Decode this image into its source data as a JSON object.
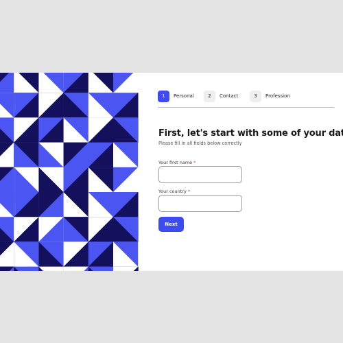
{
  "colors": {
    "accent": "#3d4bf0",
    "accent_dark": "#14105c",
    "accent_light": "#4a55f2",
    "required": "#e23b3b"
  },
  "steps": [
    {
      "number": "1",
      "label": "Personal",
      "active": true
    },
    {
      "number": "2",
      "label": "Contact",
      "active": false
    },
    {
      "number": "3",
      "label": "Profession",
      "active": false
    }
  ],
  "form": {
    "title": "First, let's start with some of your data",
    "subtitle": "Please fill in all fields below correctly",
    "fields": {
      "first_name": {
        "label": "Your first name",
        "required_mark": "*",
        "value": "",
        "placeholder": ""
      },
      "country": {
        "label": "Your country",
        "required_mark": "*",
        "value": "",
        "placeholder": ""
      }
    },
    "next_label": "Next"
  }
}
